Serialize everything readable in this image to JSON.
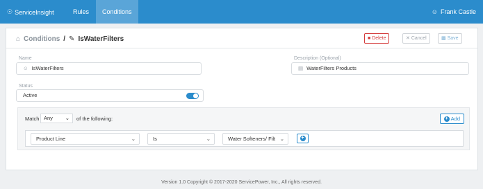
{
  "nav": {
    "brand": "ServiceInsight",
    "links": [
      "Rules",
      "Conditions"
    ],
    "user": "Frank Castle",
    "accent": "#2b8ccc"
  },
  "header": {
    "crumb_parent": "Conditions",
    "separator": "/",
    "title": "IsWaterFilters",
    "delete_label": "Delete",
    "cancel_label": "Cancel",
    "save_label": "Save"
  },
  "form": {
    "name_label": "Name",
    "name_value": "IsWaterFilters",
    "desc_label": "Description (Optional)",
    "desc_value": "WaterFilters Products",
    "status_label": "Status",
    "status_value": "Active"
  },
  "match": {
    "prefix": "Match",
    "mode": "Any",
    "suffix": "of the following:",
    "add_label": "Add"
  },
  "condition_row": {
    "field": "Product Line",
    "operator": "Is",
    "value": "Water Softeners/ Filt"
  },
  "footer": {
    "text": "Version 1.0 Copyright © 2017-2020 ServicePower, Inc., All rights reserved."
  }
}
